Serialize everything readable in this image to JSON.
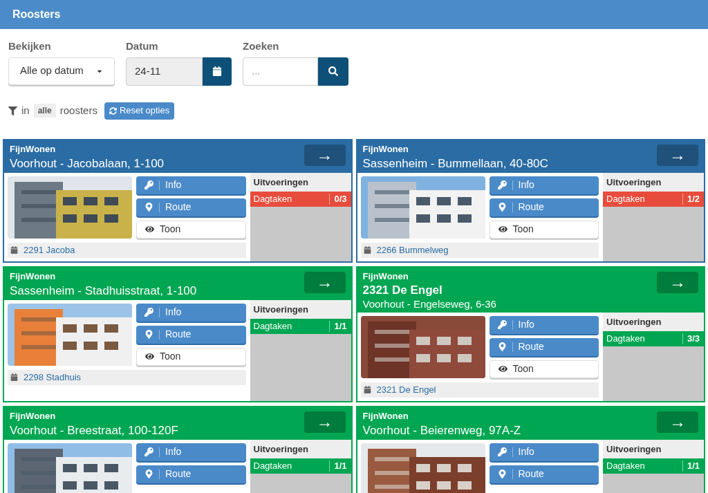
{
  "header": {
    "title": "Roosters"
  },
  "filters": {
    "view": {
      "label": "Bekijken",
      "value": "Alle op datum"
    },
    "date": {
      "label": "Datum",
      "value": "24-11"
    },
    "search": {
      "label": "Zoeken",
      "placeholder": "..."
    }
  },
  "filter_summary": {
    "prefix": "in",
    "badge": "alle",
    "suffix": "roosters",
    "reset_button": "Reset opties"
  },
  "cards": [
    {
      "color": "#2a6ca3",
      "company": "FijnWonen",
      "address": "Voorhout - Jacobalaan, 1-100",
      "arrow": "→",
      "buttons": [
        {
          "kind": "info",
          "label": "Info"
        },
        {
          "kind": "route",
          "label": "Route"
        },
        {
          "kind": "toon",
          "label": "Toon"
        }
      ],
      "footer": "2291 Jacoba",
      "panel_title": "Uitvoeringen",
      "task": {
        "label": "Dagtaken",
        "count": "0/3",
        "color": "#e74c3c"
      }
    },
    {
      "color": "#2a6ca3",
      "company": "FijnWonen",
      "address": "Sassenheim - Bummellaan, 40-80C",
      "arrow": "→",
      "buttons": [
        {
          "kind": "info",
          "label": "Info"
        },
        {
          "kind": "route",
          "label": "Route"
        },
        {
          "kind": "toon",
          "label": "Toon"
        }
      ],
      "footer": "2266 Bummelweg",
      "panel_title": "Uitvoeringen",
      "task": {
        "label": "Dagtaken",
        "count": "1/2",
        "color": "#e74c3c"
      }
    },
    {
      "color": "#00a651",
      "company": "FijnWonen",
      "address": "Sassenheim - Stadhuisstraat, 1-100",
      "arrow": "→",
      "buttons": [
        {
          "kind": "info",
          "label": "Info"
        },
        {
          "kind": "route",
          "label": "Route"
        },
        {
          "kind": "toon",
          "label": "Toon"
        }
      ],
      "footer": "2298 Stadhuis",
      "panel_title": "Uitvoeringen",
      "task": {
        "label": "Dagtaken",
        "count": "1/1",
        "color": "#00a651"
      }
    },
    {
      "color": "#00a651",
      "company": "FijnWonen",
      "name": "2321 De Engel",
      "address": "Voorhout - Engelseweg, 6-36",
      "arrow": "→",
      "buttons": [
        {
          "kind": "info",
          "label": "Info"
        },
        {
          "kind": "route",
          "label": "Route"
        },
        {
          "kind": "toon",
          "label": "Toon"
        }
      ],
      "footer": "2321 De Engel",
      "panel_title": "Uitvoeringen",
      "task": {
        "label": "Dagtaken",
        "count": "3/3",
        "color": "#00a651"
      }
    },
    {
      "color": "#00a651",
      "company": "FijnWonen",
      "address": "Voorhout - Breestraat, 100-120F",
      "arrow": "→",
      "buttons": [
        {
          "kind": "info",
          "label": "Info"
        },
        {
          "kind": "route",
          "label": "Route"
        }
      ],
      "panel_title": "Uitvoeringen",
      "task": {
        "label": "Dagtaken",
        "count": "1/1",
        "color": "#00a651"
      }
    },
    {
      "color": "#00a651",
      "company": "FijnWonen",
      "address": "Voorhout - Beierenweg, 97A-Z",
      "arrow": "→",
      "buttons": [
        {
          "kind": "info",
          "label": "Info"
        },
        {
          "kind": "route",
          "label": "Route"
        }
      ],
      "panel_title": "Uitvoeringen",
      "task": {
        "label": "Dagtaken",
        "count": "1/1",
        "color": "#00a651"
      }
    }
  ]
}
